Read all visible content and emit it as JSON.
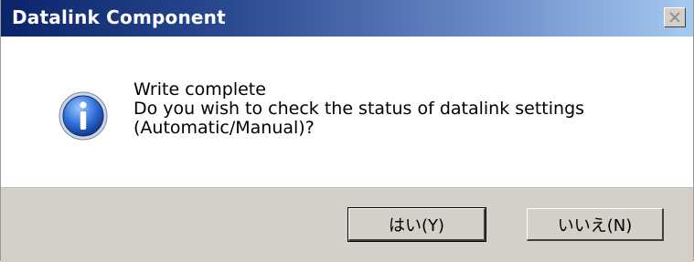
{
  "window": {
    "title": "Datalink Component",
    "close_glyph": "✕"
  },
  "message": {
    "icon": "info-icon",
    "lines": [
      "Write complete",
      "Do you wish to check the status of datalink settings",
      "(Automatic/Manual)?"
    ]
  },
  "buttons": {
    "yes_label": "はい(Y)",
    "no_label": "いいえ(N)"
  },
  "colors": {
    "title_start": "#0a246a",
    "title_end": "#a6caf0",
    "footer_bg": "#d4d0c8"
  }
}
